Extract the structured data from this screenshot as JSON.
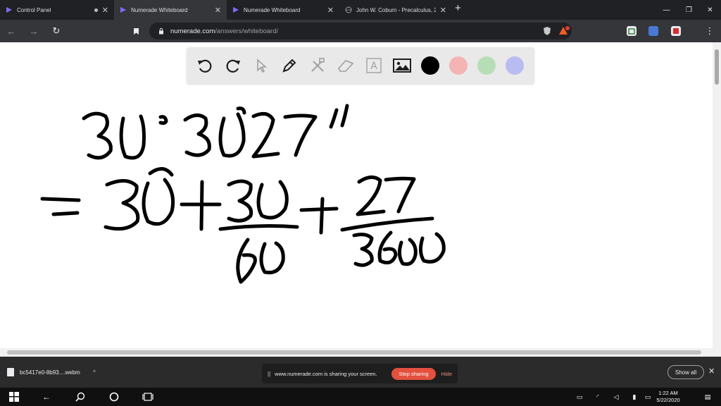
{
  "tabs": [
    {
      "title": "Control Panel",
      "active": false
    },
    {
      "title": "Numerade Whiteboard",
      "active": true
    },
    {
      "title": "Numerade Whiteboard",
      "active": false
    },
    {
      "title": "John W. Coburn - Precalculus, 2e",
      "active": false
    }
  ],
  "address": {
    "host": "numerade.com",
    "path": "/answers/whiteboard/"
  },
  "whiteboard": {
    "tools": [
      "undo-icon",
      "redo-icon",
      "pointer-icon",
      "pen-icon",
      "tools-icon",
      "eraser-icon",
      "text-icon",
      "image-icon"
    ],
    "text_tool_glyph": "A",
    "colors": [
      "#000000",
      "#f4b4b4",
      "#b7ddb7",
      "#b8bcf0"
    ]
  },
  "download": {
    "filename": "bc5417e0-8b93....webm"
  },
  "share": {
    "message": "www.numerade.com is sharing your screen.",
    "stop_label": "Stop sharing",
    "hide_label": "Hide"
  },
  "shelf": {
    "show_all_label": "Show all"
  },
  "clock": {
    "time": "1:22 AM",
    "date": "5/22/2020"
  }
}
